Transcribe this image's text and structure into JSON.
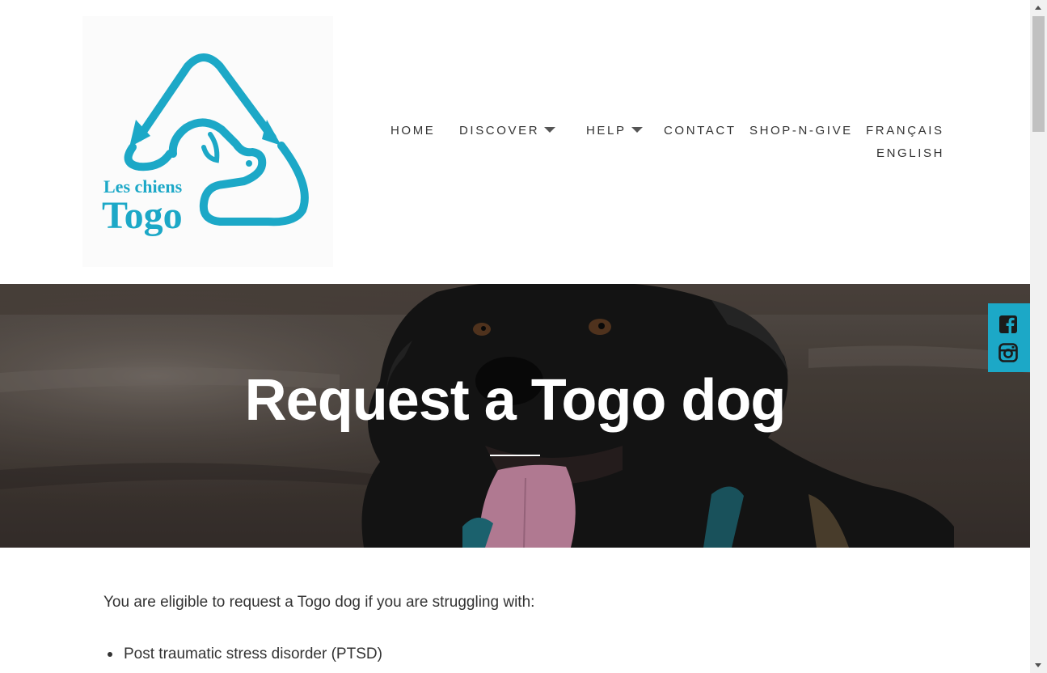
{
  "logo": {
    "line1": "Les chiens",
    "line2": "Togo",
    "brand_color": "#1ca8c7",
    "icon": "recycle-triangle-dog-logo"
  },
  "nav": {
    "items": [
      {
        "label": "HOME"
      },
      {
        "label": "DISCOVER",
        "has_dropdown": true
      },
      {
        "label": "HELP",
        "has_dropdown": true
      },
      {
        "label": "CONTACT"
      },
      {
        "label": "SHOP-N-GIVE"
      },
      {
        "label": "FRANÇAIS"
      },
      {
        "label": "ENGLISH"
      }
    ]
  },
  "hero": {
    "title": "Request a Togo dog",
    "image": "black dog with tongue out, blurred ground background"
  },
  "social": {
    "background": "#1ca8c7",
    "icons": [
      "facebook-icon",
      "instagram-icon"
    ]
  },
  "content": {
    "intro": "You are eligible to request a Togo dog if you are struggling with:",
    "list": [
      "Post traumatic stress disorder (PTSD)"
    ]
  }
}
